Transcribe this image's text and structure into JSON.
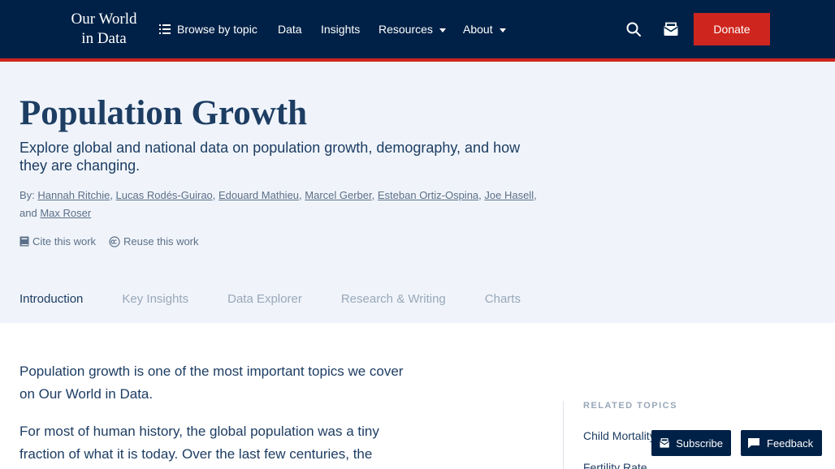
{
  "header": {
    "logo_line1": "Our World",
    "logo_line2": "in Data",
    "nav": {
      "browse": "Browse by topic",
      "data": "Data",
      "insights": "Insights",
      "resources": "Resources",
      "about": "About"
    },
    "donate": "Donate",
    "icons": {
      "search": "search-icon",
      "newsletter": "newsletter-icon",
      "browse": "list-icon"
    },
    "colors": {
      "background": "#002147",
      "accent": "#ce261e"
    }
  },
  "hero": {
    "title": "Population Growth",
    "subtitle": "Explore global and national data on population growth, demography, and how they are changing.",
    "by_label": "By:",
    "authors": [
      "Hannah Ritchie",
      "Lucas Rodés-Guirao",
      "Edouard Mathieu",
      "Marcel Gerber",
      "Esteban Ortiz-Ospina",
      "Joe Hasell",
      "Max Roser"
    ],
    "and_label": "and",
    "cite_label": "Cite this work",
    "reuse_label": "Reuse this work"
  },
  "tabs": [
    "Introduction",
    "Key Insights",
    "Data Explorer",
    "Research & Writing",
    "Charts"
  ],
  "article": {
    "p1": "Population growth is one of the most important topics we cover on Our World in Data.",
    "p2": "For most of human history, the global population was a tiny fraction of what it is today. Over the last few centuries, the"
  },
  "related": {
    "heading": "RELATED TOPICS",
    "items": [
      "Child Mortality",
      "Fertility Rate"
    ]
  },
  "floating": {
    "subscribe": "Subscribe",
    "feedback": "Feedback"
  }
}
